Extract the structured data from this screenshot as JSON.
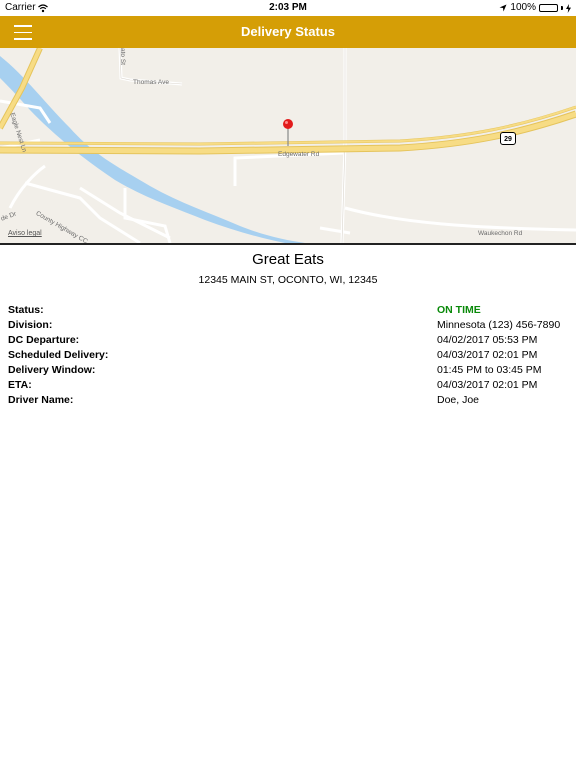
{
  "status_bar": {
    "carrier": "Carrier",
    "time": "2:03 PM",
    "battery": "100%"
  },
  "nav": {
    "title": "Delivery Status"
  },
  "map": {
    "legal": "Aviso legal",
    "route_shield": "29",
    "streets": {
      "thomas": "Thomas Ave",
      "edgewater": "Edgewater Rd",
      "county": "County Highway CC",
      "eagle_nest": "Eagle Nest Ln",
      "waukechon": "Waukechon Rd",
      "top_street": "ato St",
      "left_street": "de Dr"
    }
  },
  "store": {
    "name": "Great Eats",
    "address": "12345 MAIN ST, OCONTO, WI, 12345"
  },
  "details": [
    {
      "label": "Status:",
      "value": "ON TIME"
    },
    {
      "label": "Division:",
      "value": "Minnesota (123) 456-7890"
    },
    {
      "label": "DC Departure:",
      "value": "04/02/2017 05:53 PM"
    },
    {
      "label": "Scheduled Delivery:",
      "value": "04/03/2017 02:01 PM"
    },
    {
      "label": "Delivery Window:",
      "value": "01:45 PM to 03:45 PM"
    },
    {
      "label": "ETA:",
      "value": "04/03/2017 02:01 PM"
    },
    {
      "label": "Driver Name:",
      "value": "Doe, Joe"
    }
  ],
  "colors": {
    "nav": "#d59e06",
    "status_on_time": "#0a8a0a",
    "water": "#a7d0f0",
    "highway": "#f7dc85"
  }
}
